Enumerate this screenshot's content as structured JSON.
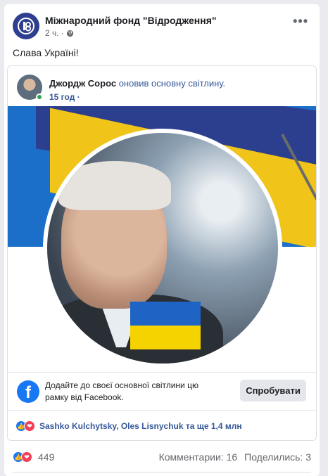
{
  "post": {
    "author": "Міжнародний фонд \"Відродження\"",
    "time": "2 ч.",
    "privacy_icon": "globe-icon",
    "more_icon": "more-horizontal-icon",
    "text": "Слава Україні!"
  },
  "shared_post": {
    "author": "Джордж Сорос",
    "action": "оновив основну світлину.",
    "time": "15 год",
    "frame_promo": {
      "text": "Додайте до своєї основної світлини цю рамку від Facebook.",
      "button": "Спробувати"
    },
    "reactions_text": "Sashko Kulchytsky, Oles Lisnychuk та ще 1,4 млн"
  },
  "footer": {
    "reactions_count": "449",
    "comments": "Комментарии: 16",
    "shares": "Поделились: 3"
  },
  "colors": {
    "facebook_blue": "#1877f2",
    "link_blue": "#365899",
    "ukraine_blue": "#1f63c4",
    "ukraine_yellow": "#f5d300"
  }
}
